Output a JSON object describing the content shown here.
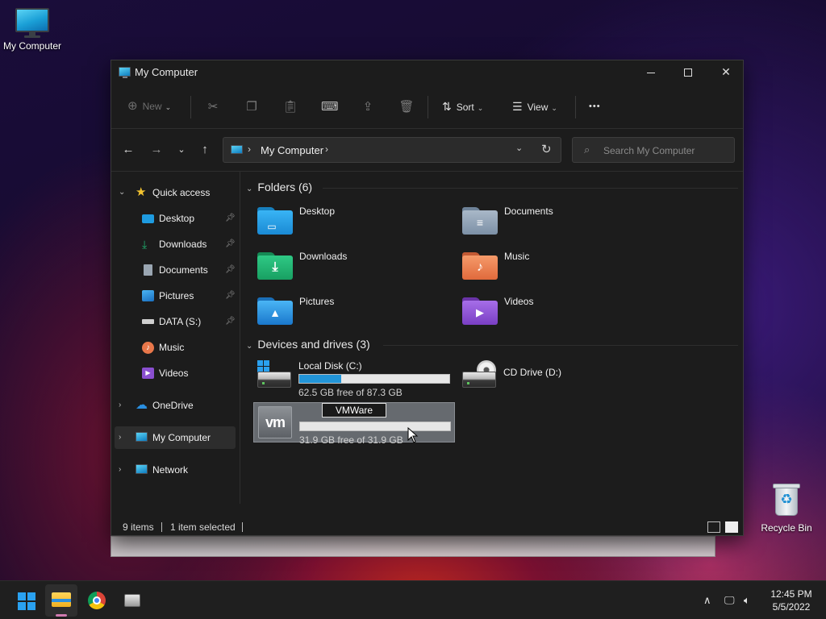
{
  "desktop": {
    "icons": [
      {
        "label": "My Computer"
      },
      {
        "label": "Recycle Bin"
      }
    ]
  },
  "window": {
    "title": "My Computer",
    "controls": {
      "minimize": "—",
      "maximize": "☐",
      "close": "✕"
    }
  },
  "toolbar": {
    "new_label": "New",
    "sort_label": "Sort",
    "view_label": "View",
    "more_label": "•••"
  },
  "address": {
    "crumb": "My Computer",
    "search_placeholder": "Search My Computer"
  },
  "sidebar": {
    "quick_access": "Quick access",
    "items": [
      {
        "label": "Desktop",
        "pinned": true
      },
      {
        "label": "Downloads",
        "pinned": true
      },
      {
        "label": "Documents",
        "pinned": true
      },
      {
        "label": "Pictures",
        "pinned": true
      },
      {
        "label": "DATA (S:)",
        "pinned": true
      },
      {
        "label": "Music",
        "pinned": false
      },
      {
        "label": "Videos",
        "pinned": false
      }
    ],
    "onedrive": "OneDrive",
    "mycomputer": "My Computer",
    "network": "Network"
  },
  "folders": {
    "heading": "Folders (6)",
    "items": [
      {
        "label": "Desktop",
        "icon": "desktop-folder-icon",
        "color": "#1e9be0"
      },
      {
        "label": "Documents",
        "icon": "documents-folder-icon",
        "color": "#8aa0b8"
      },
      {
        "label": "Downloads",
        "icon": "downloads-folder-icon",
        "color": "#1fae6e"
      },
      {
        "label": "Music",
        "icon": "music-folder-icon",
        "color": "#e8774a"
      },
      {
        "label": "Pictures",
        "icon": "pictures-folder-icon",
        "color": "#2a8fe0"
      },
      {
        "label": "Videos",
        "icon": "videos-folder-icon",
        "color": "#8a4fd0"
      }
    ]
  },
  "drives": {
    "heading": "Devices and drives (3)",
    "items": [
      {
        "label": "Local Disk (C:)",
        "free": "62.5 GB free of 87.3 GB",
        "used_fraction": 0.28
      },
      {
        "label": "CD Drive (D:)"
      },
      {
        "rename_value": "VMWare",
        "free": "31.9 GB free of 31.9 GB",
        "used_fraction": 0.0
      }
    ]
  },
  "status": {
    "items_count": "9 items",
    "selected": "1 item selected"
  },
  "taskbar": {
    "time": "12:45 PM",
    "date": "5/5/2022"
  },
  "colors": {
    "accent": "#2295d8",
    "window_bg": "#1c1c1c"
  }
}
